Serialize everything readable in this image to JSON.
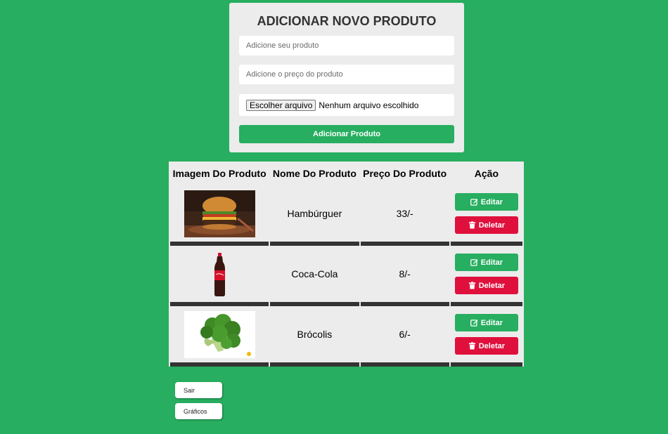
{
  "form": {
    "title": "ADICIONAR NOVO PRODUTO",
    "product_placeholder": "Adicione seu produto",
    "price_placeholder": "Adicione o preço do produto",
    "file_button_label": "Escolher arquivo",
    "file_status": "Nenhum arquivo escolhido",
    "submit_label": "Adicionar Produto"
  },
  "table": {
    "headers": [
      "Imagem Do Produto",
      "Nome Do Produto",
      "Preço Do Produto",
      "Ação"
    ],
    "rows": [
      {
        "name": "Hambúrguer",
        "price": "33/-",
        "image": "burger-image"
      },
      {
        "name": "Coca-Cola",
        "price": "8/-",
        "image": "coca-cola-bottle-image"
      },
      {
        "name": "Brócolis",
        "price": "6/-",
        "image": "broccoli-image"
      }
    ],
    "edit_label": "Editar",
    "delete_label": "Deletar"
  },
  "nav": {
    "logout_label": "Sair",
    "charts_label": "Gráficos"
  },
  "colors": {
    "background": "#27ae60",
    "accent": "#27ae60",
    "danger": "#e0103d",
    "card": "#ececec"
  }
}
